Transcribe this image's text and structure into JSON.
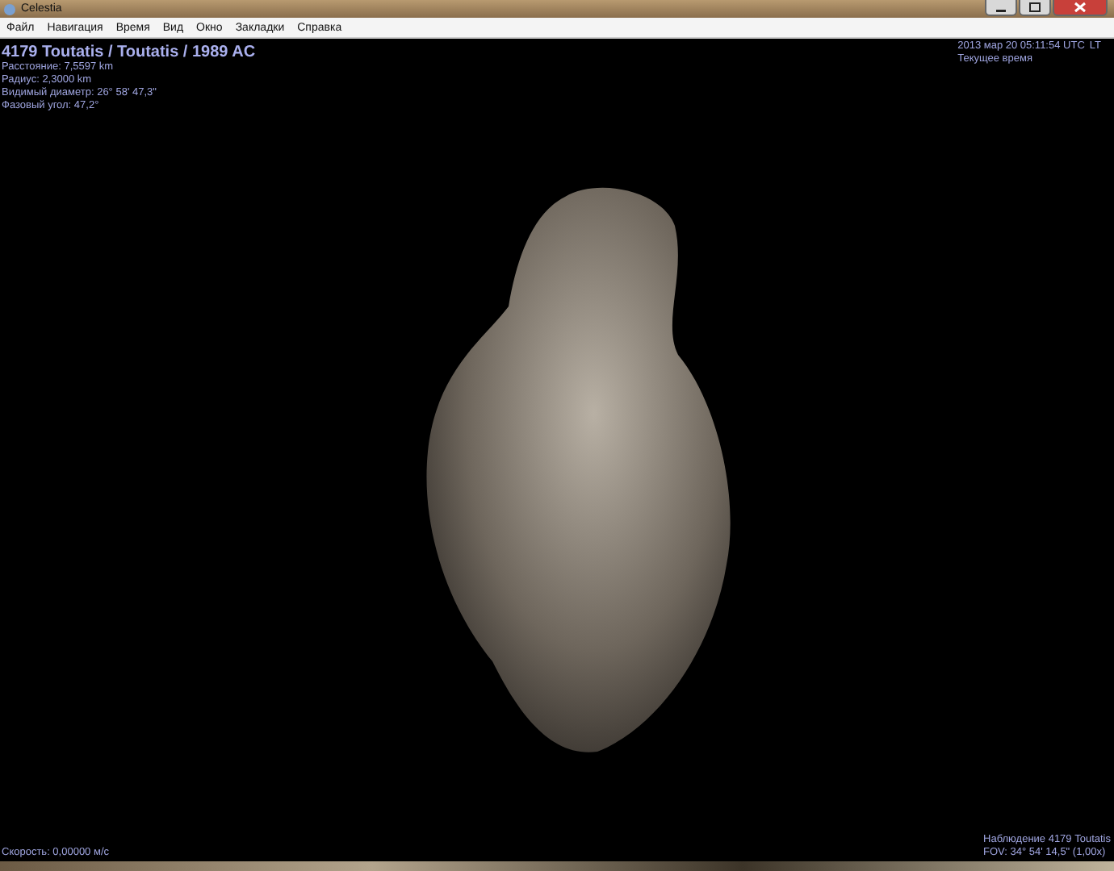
{
  "window": {
    "title": "Celestia"
  },
  "menu": [
    "Файл",
    "Навигация",
    "Время",
    "Вид",
    "Окно",
    "Закладки",
    "Справка"
  ],
  "object_info": {
    "name": "4179 Toutatis / Toutatis / 1989 AC",
    "lines": [
      "Расстояние: 7,5597 km",
      "Радиус: 2,3000 km",
      "Видимый диаметр: 26° 58' 47,3\"",
      "Фазовый угол: 47,2°"
    ]
  },
  "time_info": {
    "datetime": "2013 мар 20 05:11:54 UTC",
    "mode": "LT",
    "status": "Текущее время"
  },
  "speed": "Скорость: 0,00000 м/с",
  "observation": {
    "target": "Наблюдение 4179 Toutatis",
    "fov": "FOV: 34° 54' 14,5\" (1,00x)"
  }
}
